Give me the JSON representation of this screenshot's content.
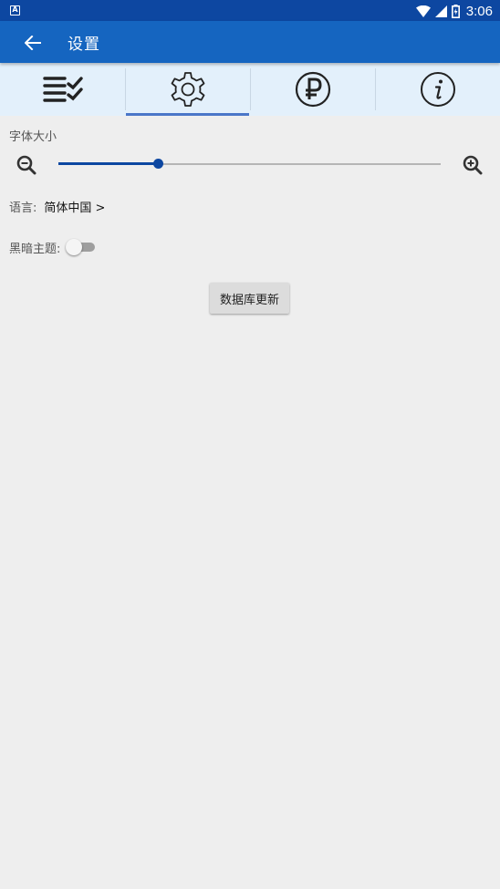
{
  "status_bar": {
    "left_icon": "A",
    "time": "3:06",
    "icons": [
      "wifi-icon",
      "signal-icon",
      "battery-icon"
    ]
  },
  "app_bar": {
    "back_icon": "arrow-left-icon",
    "title": "设置"
  },
  "tabs": [
    {
      "name": "tab-list",
      "icon": "checklist-icon",
      "active": false
    },
    {
      "name": "tab-settings",
      "icon": "gear-icon",
      "active": true
    },
    {
      "name": "tab-donate",
      "icon": "ruble-icon",
      "active": false
    },
    {
      "name": "tab-info",
      "icon": "info-icon",
      "active": false
    }
  ],
  "settings": {
    "font_size_label": "字体大小",
    "font_size_level": 0.26,
    "language_label": "语言:",
    "language_value": "简体中国 >",
    "dark_theme_label": "黑暗主题:",
    "dark_theme_on": false,
    "db_update_button": "数据库更新"
  },
  "colors": {
    "status_bar": "#0d47a1",
    "app_bar": "#1565c0",
    "tab_bar": "#e3f0fb",
    "accent": "#0d47a1",
    "background": "#eeeeee"
  }
}
